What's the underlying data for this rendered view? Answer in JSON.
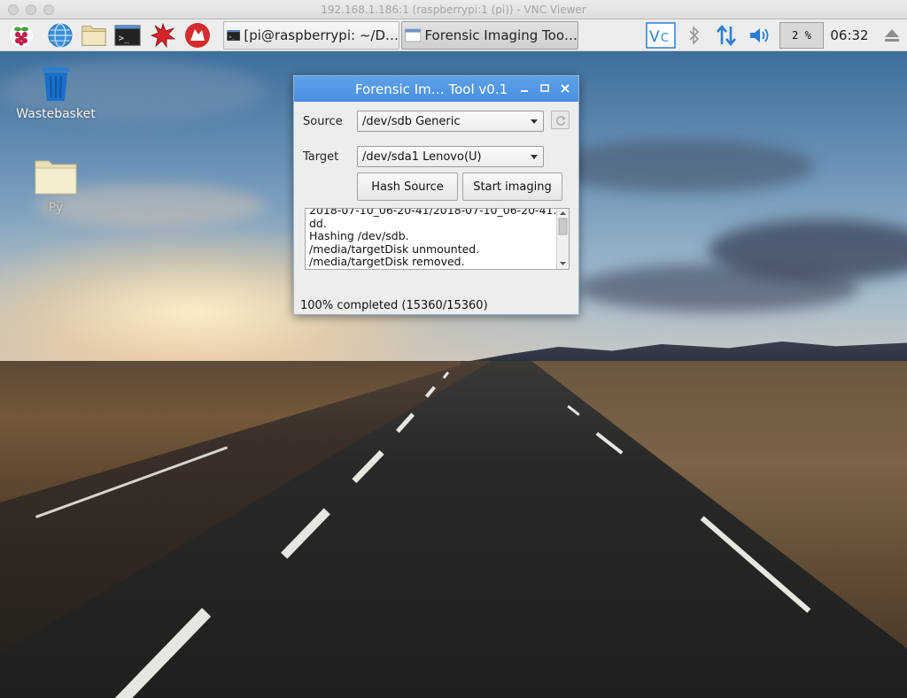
{
  "mac": {
    "title": "192.168.1.186:1 (raspberrypi:1 (pi)) - VNC Viewer"
  },
  "panel": {
    "launchers": [
      "raspberry-menu-icon",
      "web-browser-icon",
      "file-manager-icon",
      "terminal-icon",
      "mathematica-icon",
      "wolfram-icon"
    ],
    "tasks": [
      {
        "label": "[pi@raspberrypi: ~/D…",
        "active": false
      },
      {
        "label": "Forensic Imaging Too…",
        "active": true
      }
    ],
    "tray": {
      "cpu": "2 %",
      "clock": "06:32"
    }
  },
  "desktop": {
    "icons": [
      {
        "label": "Wastebasket",
        "icon": "trash-icon"
      },
      {
        "label": "Py",
        "icon": "folder-icon"
      }
    ]
  },
  "app": {
    "title": "Forensic Im… Tool v0.1",
    "source_label": "Source",
    "source_value": "/dev/sdb Generic",
    "target_label": "Target",
    "target_value": "/dev/sda1 Lenovo(U)",
    "hash_button": "Hash Source",
    "start_button": "Start imaging",
    "log": [
      "2018-07-10_06-20-41/2018-07-10_06-20-41.",
      "dd.",
      "Hashing /dev/sdb.",
      "/media/targetDisk unmounted.",
      "/media/targetDisk removed."
    ],
    "status": "100% completed (15360/15360)"
  },
  "colors": {
    "titlebar": "#4a90e2",
    "panel": "#ededed",
    "accent_blue": "#2a7fd4"
  }
}
